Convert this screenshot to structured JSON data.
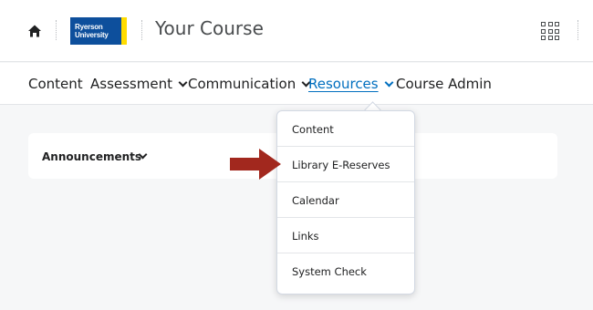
{
  "header": {
    "logo_line1": "Ryerson",
    "logo_line2": "University",
    "course_title": "Your Course"
  },
  "nav": {
    "items": [
      {
        "label": "Content",
        "has_menu": false
      },
      {
        "label": "Assessment",
        "has_menu": true
      },
      {
        "label": "Communication",
        "has_menu": true
      },
      {
        "label": "Resources",
        "has_menu": true,
        "active": true
      },
      {
        "label": "Course Admin",
        "has_menu": false
      }
    ]
  },
  "resources_menu": {
    "items": [
      {
        "label": "Content"
      },
      {
        "label": "Library E-Reserves",
        "highlighted": true
      },
      {
        "label": "Calendar"
      },
      {
        "label": "Links"
      },
      {
        "label": "System Check"
      }
    ]
  },
  "widget": {
    "title": "Announcements"
  },
  "colors": {
    "brand_blue": "#0d4f9c",
    "brand_yellow": "#ffdc00",
    "active_link": "#006fbf",
    "arrow": "#a2281e"
  },
  "icons": [
    "home-icon",
    "app-launcher-icon",
    "chevron-down-icon",
    "pointer-arrow-icon"
  ]
}
